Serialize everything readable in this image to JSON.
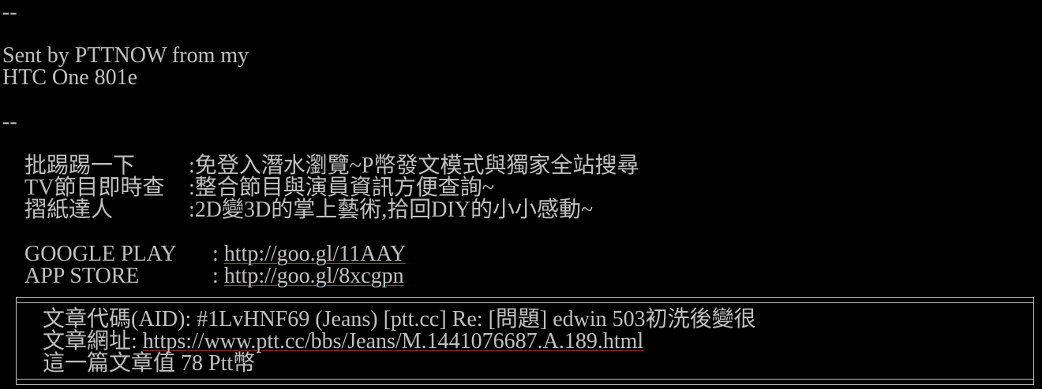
{
  "signature": {
    "sep1": "--",
    "sent_line1": "Sent by PTTNOW from my",
    "sent_line2": "HTC One 801e",
    "sep2": "--",
    "promos": [
      {
        "name": "批踢踢一下",
        "sep": ":",
        "desc": "免登入潛水瀏覽~P幣發文模式與獨家全站搜尋"
      },
      {
        "name": "TV節目即時查",
        "sep": ":",
        "desc": "整合節目與演員資訊方便查詢~"
      },
      {
        "name": "摺紙達人",
        "sep": ":",
        "desc": "2D變3D的掌上藝術,拾回DIY的小小感動~"
      }
    ],
    "stores": [
      {
        "name": "GOOGLE PLAY",
        "sep": ": ",
        "url": "http://goo.gl/11AAY"
      },
      {
        "name": "APP STORE",
        "sep": ": ",
        "url": "http://goo.gl/8xcgpn"
      }
    ]
  },
  "article_info": {
    "aid_line": "文章代碼(AID): #1LvHNF69 (Jeans) [ptt.cc] Re: [問題] edwin 503初洗後變很",
    "url_label": "文章網址: ",
    "url": "https://www.ptt.cc/bbs/Jeans/M.1441076687.A.189.html",
    "value_line": "這一篇文章值 78 Ptt幣"
  },
  "colors": {
    "background": "#000000",
    "text": "#c0c0c0",
    "link_underline": "#c03030"
  }
}
